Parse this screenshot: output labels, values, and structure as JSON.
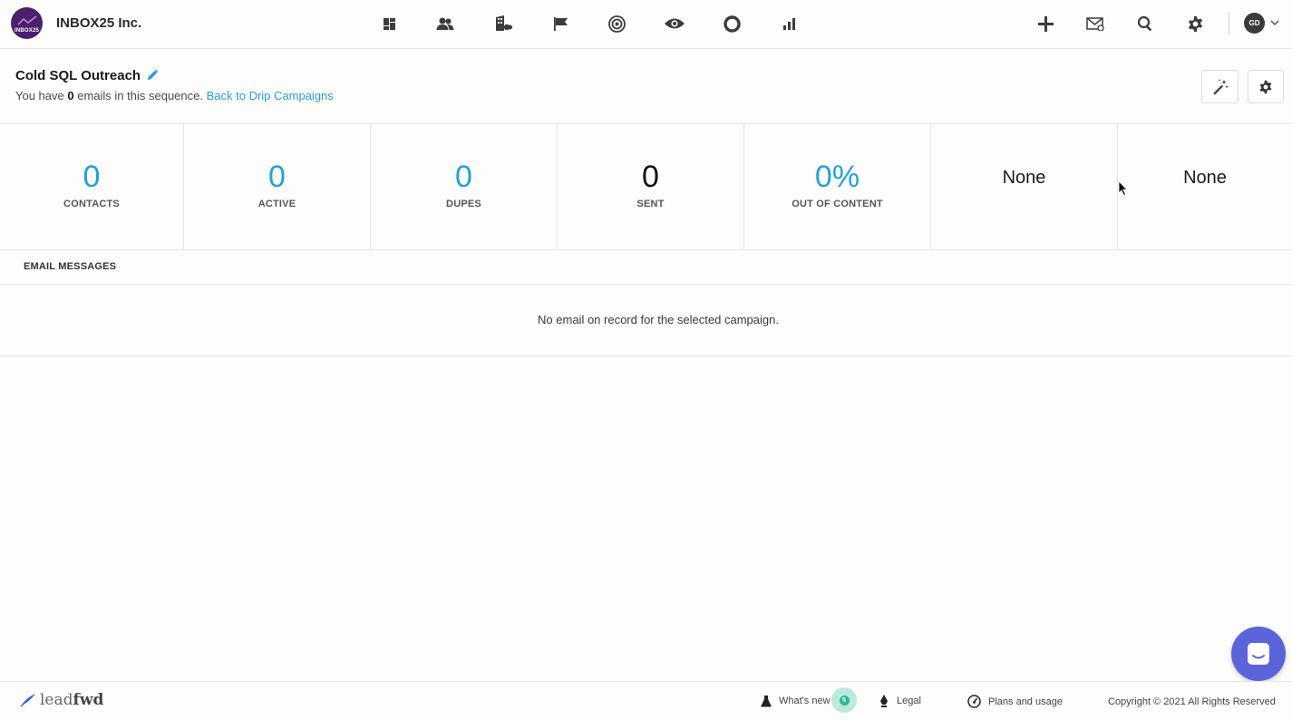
{
  "topbar": {
    "company": "INBOX25 Inc.",
    "logo_text": "INBOX25",
    "avatar_initials": "GD",
    "nav_icons": [
      "dashboard-icon",
      "contacts-icon",
      "companies-icon",
      "flag-icon",
      "target-icon",
      "eye-icon",
      "circle-icon",
      "bar-chart-icon"
    ],
    "action_icons": [
      "plus-icon",
      "mail-icon",
      "search-icon",
      "gear-icon"
    ]
  },
  "header": {
    "title": "Cold SQL Outreach",
    "subtitle_prefix": "You have",
    "email_count": "0",
    "subtitle_suffix": "emails in this sequence.",
    "back_link": "Back to Drip Campaigns"
  },
  "stats": [
    {
      "value": "0",
      "label": "CONTACTS"
    },
    {
      "value": "0",
      "label": "ACTIVE"
    },
    {
      "value": "0",
      "label": "DUPES"
    },
    {
      "value": "0",
      "label": "SENT"
    },
    {
      "value": "0%",
      "label": "OUT OF CONTENT"
    },
    {
      "value": "None",
      "label": ""
    },
    {
      "value": "None",
      "label": ""
    }
  ],
  "emails": {
    "section_title": "EMAIL MESSAGES",
    "empty_message": "No email on record for the selected campaign."
  },
  "footer": {
    "logo_lead": "lead",
    "logo_fwd": "fwd",
    "whats_new": "What's new",
    "whats_new_count": "5",
    "legal": "Legal",
    "plans": "Plans and usage",
    "copyright": "Copyright © 2021 All Rights Reserved"
  },
  "colors": {
    "accent": "#2a9fd6",
    "brand_purple": "#4b1f6b",
    "chat": "#5b64d9",
    "badge": "#2fb88f"
  }
}
